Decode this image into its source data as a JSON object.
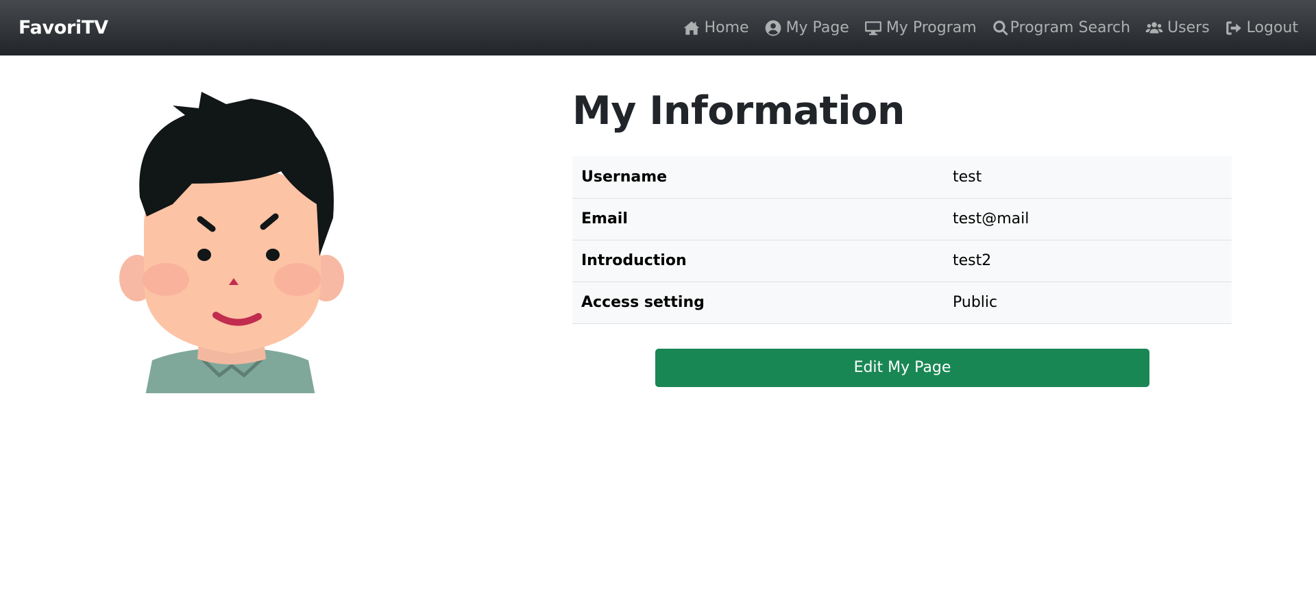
{
  "navbar": {
    "brand": "FavoriTV",
    "links": [
      {
        "label": "Home",
        "icon": "home-icon"
      },
      {
        "label": "My Page",
        "icon": "user-circle-icon"
      },
      {
        "label": "My Program",
        "icon": "desktop-icon"
      },
      {
        "label": "Program Search",
        "icon": "search-icon"
      },
      {
        "label": "Users",
        "icon": "users-icon"
      },
      {
        "label": "Logout",
        "icon": "logout-icon"
      }
    ]
  },
  "profile": {
    "title": "My Information",
    "rows": [
      {
        "label": "Username",
        "value": "test"
      },
      {
        "label": "Email",
        "value": "test@mail"
      },
      {
        "label": "Introduction",
        "value": "test2"
      },
      {
        "label": "Access setting",
        "value": "Public"
      }
    ],
    "edit_button": "Edit My Page"
  },
  "colors": {
    "navbar": "#212529",
    "button": "#198754",
    "table_bg": "#f8f9fa"
  }
}
